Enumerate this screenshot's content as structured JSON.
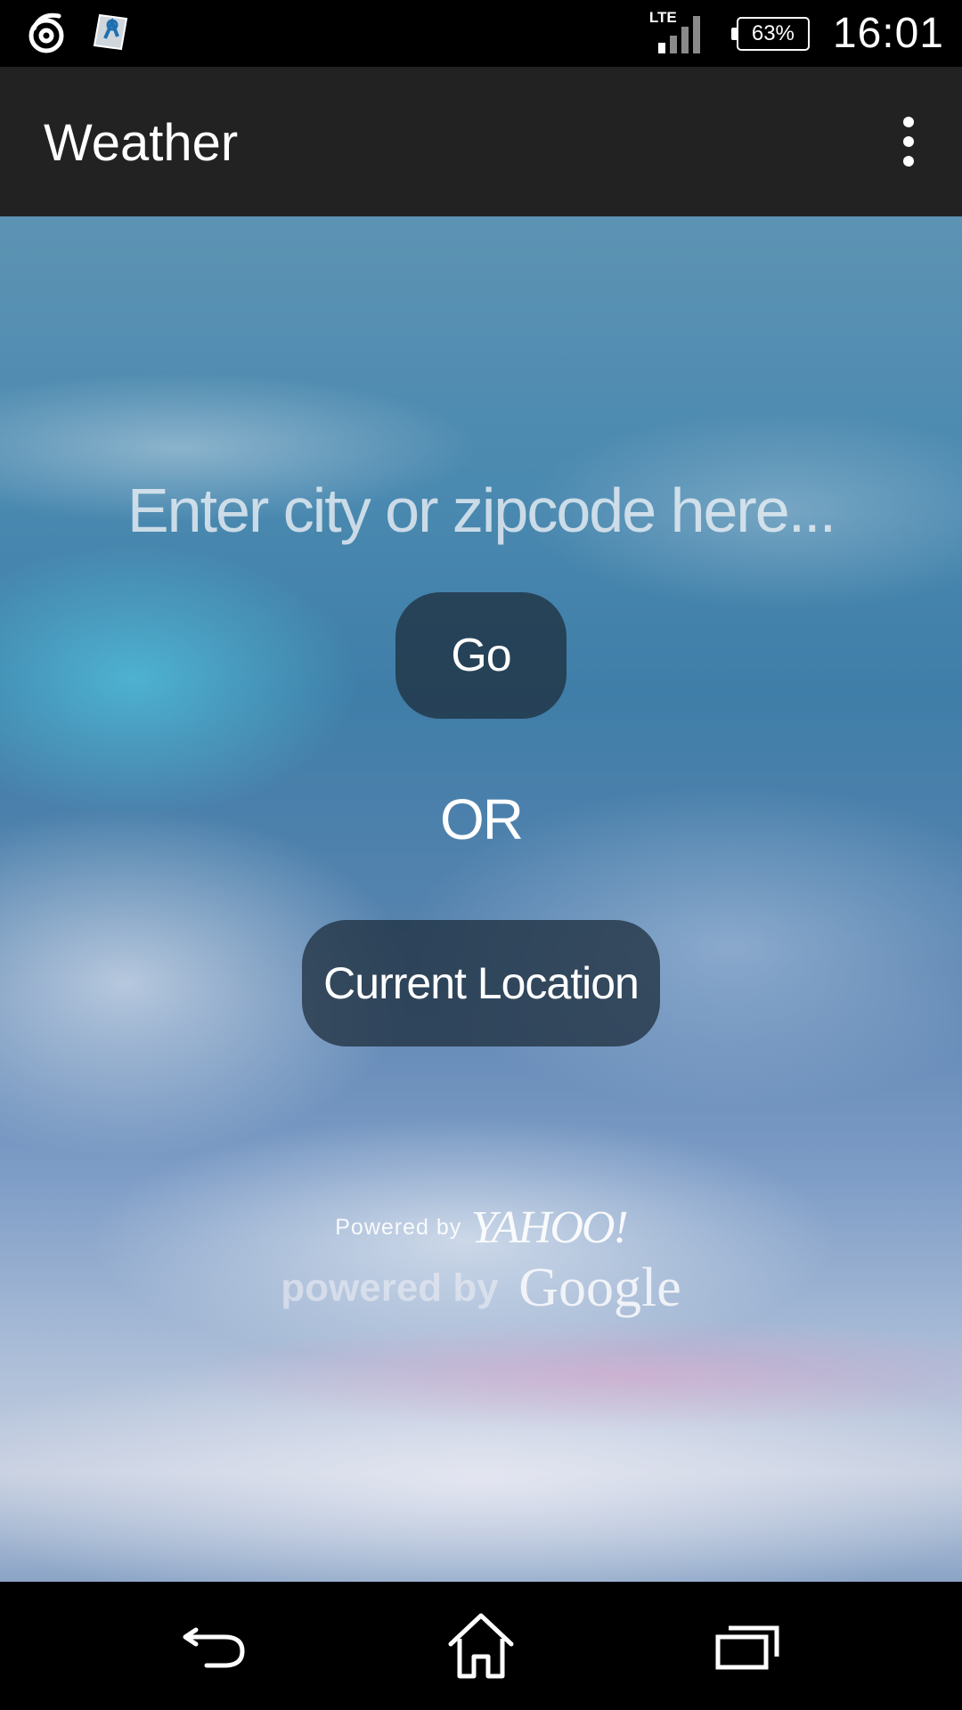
{
  "status_bar": {
    "network_type": "LTE",
    "battery_percent": "63%",
    "time": "16:01",
    "icons": [
      "notification-swirl-icon",
      "sim-toolkit-icon",
      "signal-icon",
      "battery-icon"
    ]
  },
  "action_bar": {
    "title": "Weather",
    "menu_icon": "overflow-menu-icon"
  },
  "main": {
    "search_placeholder": "Enter city or zipcode here...",
    "search_value": "",
    "go_label": "Go",
    "or_label": "OR",
    "current_location_label": "Current Location",
    "yahoo_powered_by": "Powered by",
    "yahoo_logo": "YAHOO!",
    "google_powered_by": "powered by",
    "google_logo": "Google"
  },
  "nav_bar": {
    "icons": [
      "back-icon",
      "home-icon",
      "recent-apps-icon"
    ]
  },
  "colors": {
    "status_bar_bg": "#000000",
    "action_bar_bg": "#222222",
    "button_bg": "rgba(30,45,60,0.75)",
    "text": "#ffffff"
  }
}
